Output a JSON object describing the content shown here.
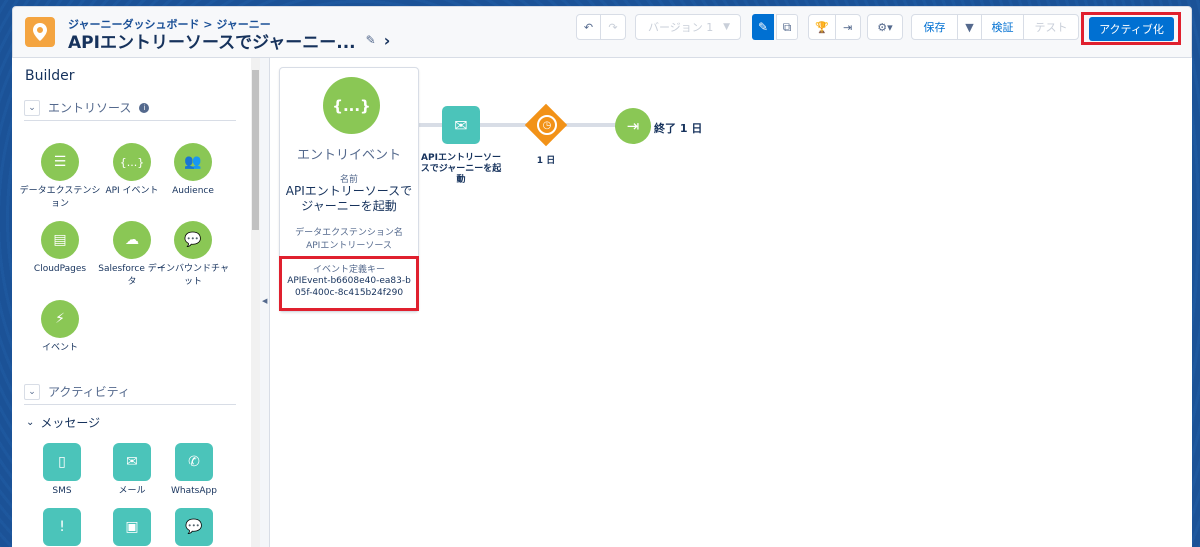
{
  "header": {
    "breadcrumb": "ジャーニーダッシュボード > ジャーニー",
    "title": "APIエントリーソースでジャーニー...",
    "version_label": "バージョン 1",
    "save_label": "保存",
    "validate_label": "検証",
    "test_label": "テスト",
    "activate_label": "アクティブ化"
  },
  "sidebar": {
    "title": "Builder",
    "entry_section": "エントリソース",
    "entry_items": [
      {
        "label": "データエクステンション",
        "icon": "list-icon"
      },
      {
        "label": "API イベント",
        "icon": "braces-icon"
      },
      {
        "label": "Audience",
        "icon": "group-icon"
      },
      {
        "label": "CloudPages",
        "icon": "page-icon"
      },
      {
        "label": "Salesforce データ",
        "icon": "cloud-icon"
      },
      {
        "label": "インバウンドチャット",
        "icon": "chat-icon"
      },
      {
        "label": "イベント",
        "icon": "bolt-icon"
      }
    ],
    "activity_section": "アクティビティ",
    "message_sub": "メッセージ",
    "message_items": [
      {
        "label": "SMS",
        "icon": "phone-icon"
      },
      {
        "label": "メール",
        "icon": "mail-icon"
      },
      {
        "label": "WhatsApp",
        "icon": "whatsapp-icon"
      }
    ]
  },
  "canvas": {
    "entry_card": {
      "title": "エントリイベント",
      "name_label": "名前",
      "name": "APIエントリーソースでジャーニーを起動",
      "de_label": "データエクステンション名",
      "de_value": "APIエントリーソース",
      "key_label": "イベント定義キー",
      "key_value": "APIEvent-b6608e40-ea83-b05f-400c-8c415b24f290"
    },
    "email_node_label": "APIエントリーソースでジャーニーを起動",
    "wait_node_label": "1 日",
    "exit_node_label": "終了 1 日"
  },
  "colors": {
    "brand_blue": "#0070d2",
    "highlight_red": "#e0202e",
    "entry_green": "#8ac755",
    "message_teal": "#4bc4ba",
    "wait_orange": "#f29218"
  }
}
